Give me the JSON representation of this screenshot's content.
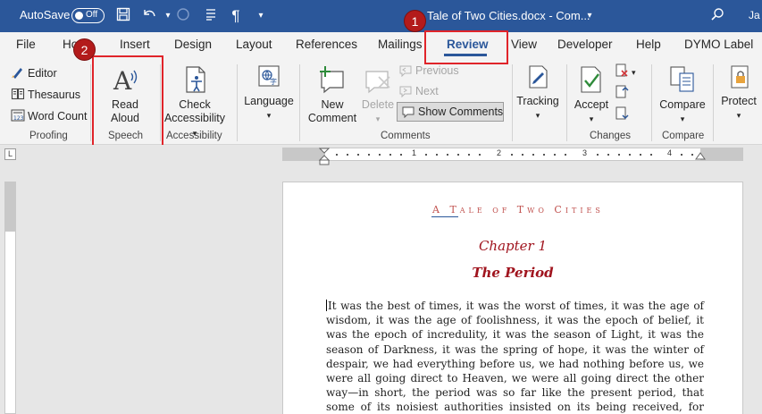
{
  "titlebar": {
    "autosave_label": "AutoSave",
    "autosave_state": "Off",
    "doc_title": "Tale of Two Cities.docx  -  Com...",
    "user_initials": "Ja",
    "icons": [
      "save-icon",
      "undo-icon",
      "redo-icon",
      "checklist-icon",
      "pilcrow-icon",
      "customize-toolbar-icon",
      "search-icon"
    ]
  },
  "tabs": [
    "File",
    "Ho",
    "Insert",
    "Design",
    "Layout",
    "References",
    "Mailings",
    "Review",
    "View",
    "Developer",
    "Help",
    "DYMO Label"
  ],
  "active_tab": "Review",
  "ribbon": {
    "proofing": {
      "label": "Proofing",
      "editor": "Editor",
      "thesaurus": "Thesaurus",
      "word_count": "Word Count"
    },
    "speech": {
      "label": "Speech",
      "read": "Read",
      "aloud": "Aloud"
    },
    "accessibility": {
      "label": "Accessibility",
      "check": "Check",
      "accessibility_btn": "Accessibility"
    },
    "language": {
      "label": "Language"
    },
    "comments": {
      "label": "Comments",
      "new": "New",
      "comment": "Comment",
      "delete": "Delete",
      "previous": "Previous",
      "next": "Next",
      "show_comments": "Show Comments"
    },
    "tracking": {
      "label": "Tracking"
    },
    "changes": {
      "label": "Changes",
      "accept": "Accept"
    },
    "compare": {
      "label": "Compare",
      "compare_btn": "Compare"
    },
    "protect": {
      "label": "Protect"
    }
  },
  "annotations": {
    "badge1": "1",
    "badge2": "2",
    "highlight_color": "#e0242a"
  },
  "ruler": {
    "numbers": [
      "1",
      "2",
      "3",
      "4"
    ],
    "corner_glyph": "L"
  },
  "document": {
    "header": "A Tale of Two Cities",
    "chapter": "Chapter 1",
    "title": "The Period",
    "body": "It was the best of times, it was the worst of times, it was the age of wisdom, it was the age of foolishness, it was the epoch of belief, it was the epoch of incredulity, it was the season of Light, it was the season of Darkness, it was the spring of hope, it was the winter of despair, we had everything before us, we had nothing before us, we were all going direct to Heaven, we were all going direct the other way—in short, the period was so far like the present period, that some of its noisiest authorities insisted on its being received, for good or for evil, in the superlative"
  },
  "colors": {
    "titlebar": "#2b579a",
    "accent": "#2b579a",
    "heading_red": "#a0141e",
    "header_red": "#c0504d"
  }
}
